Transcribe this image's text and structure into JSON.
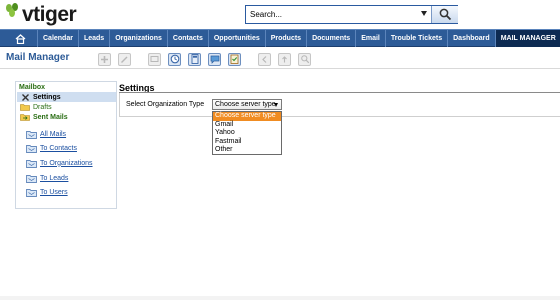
{
  "brand": {
    "logo_text": "vtiger"
  },
  "search": {
    "value": "Search..."
  },
  "nav": {
    "items": [
      {
        "label": "Calendar",
        "active": false
      },
      {
        "label": "Leads",
        "active": false
      },
      {
        "label": "Organizations",
        "active": false
      },
      {
        "label": "Contacts",
        "active": false
      },
      {
        "label": "Opportunities",
        "active": false
      },
      {
        "label": "Products",
        "active": false
      },
      {
        "label": "Documents",
        "active": false
      },
      {
        "label": "Email",
        "active": false
      },
      {
        "label": "Trouble Tickets",
        "active": false
      },
      {
        "label": "Dashboard",
        "active": false
      },
      {
        "label": "MAIL MANAGER",
        "active": true
      }
    ]
  },
  "module": {
    "title": "Mail Manager"
  },
  "sidebar": {
    "heading": "Mailbox",
    "settings_label": "Settings",
    "drafts_label": "Drafts",
    "sent_label": "Sent Mails",
    "links": [
      {
        "label": "All Mails"
      },
      {
        "label": "To Contacts"
      },
      {
        "label": "To Organizations"
      },
      {
        "label": "To Leads"
      },
      {
        "label": "To Users"
      }
    ]
  },
  "settings": {
    "title": "Settings",
    "org_type_label": "Select Organization Type",
    "selected": "Choose server type",
    "options": [
      "Choose server type",
      "Gmail",
      "Yahoo",
      "Fastmail",
      "Other"
    ]
  },
  "colors": {
    "nav_bg": "#2d5b97",
    "nav_active": "#0d2a52",
    "title_blue": "#2d5b97",
    "sidebar_green": "#2a6e14",
    "highlight_orange": "#f08c22",
    "link_blue": "#1b4fa0"
  }
}
